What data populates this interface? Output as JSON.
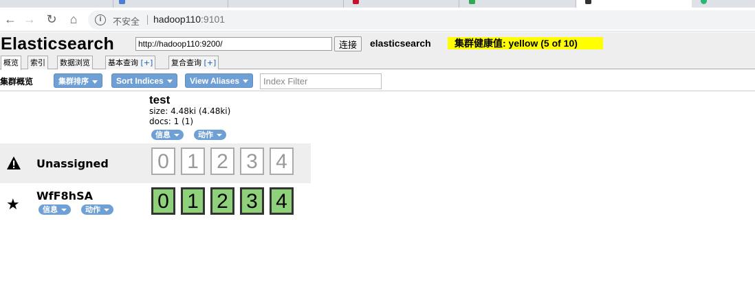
{
  "browser": {
    "insecure_label": "不安全",
    "url_host": "hadoop110",
    "url_port": ":9101"
  },
  "header": {
    "brand": "Elasticsearch",
    "connect_url": "http://hadoop110:9200/",
    "connect_label": "连接",
    "cluster_name": "elasticsearch",
    "health_text": "集群健康值: yellow (5 of 10)",
    "health_color": "#ffff00"
  },
  "tabs": [
    {
      "label": "概览",
      "plus": ""
    },
    {
      "label": "索引",
      "plus": ""
    },
    {
      "label": "数据浏览",
      "plus": ""
    },
    {
      "label": "基本查询",
      "plus": "[+]"
    },
    {
      "label": "复合查询",
      "plus": "[+]"
    }
  ],
  "controls": {
    "title": "集群概览",
    "sort_cluster": "集群排序",
    "sort_indices": "Sort Indices",
    "view_aliases": "View Aliases",
    "index_filter_placeholder": "Index Filter"
  },
  "index": {
    "name": "test",
    "size": "size: 4.48ki (4.48ki)",
    "docs": "docs: 1 (1)",
    "info_label": "信息",
    "action_label": "动作"
  },
  "unassigned": {
    "label": "Unassigned",
    "shards": [
      "0",
      "1",
      "2",
      "3",
      "4"
    ]
  },
  "node": {
    "name": "WfF8hSA",
    "info_label": "信息",
    "action_label": "动作",
    "shards": [
      "0",
      "1",
      "2",
      "3",
      "4"
    ],
    "shard_color": "#8fd07a"
  }
}
